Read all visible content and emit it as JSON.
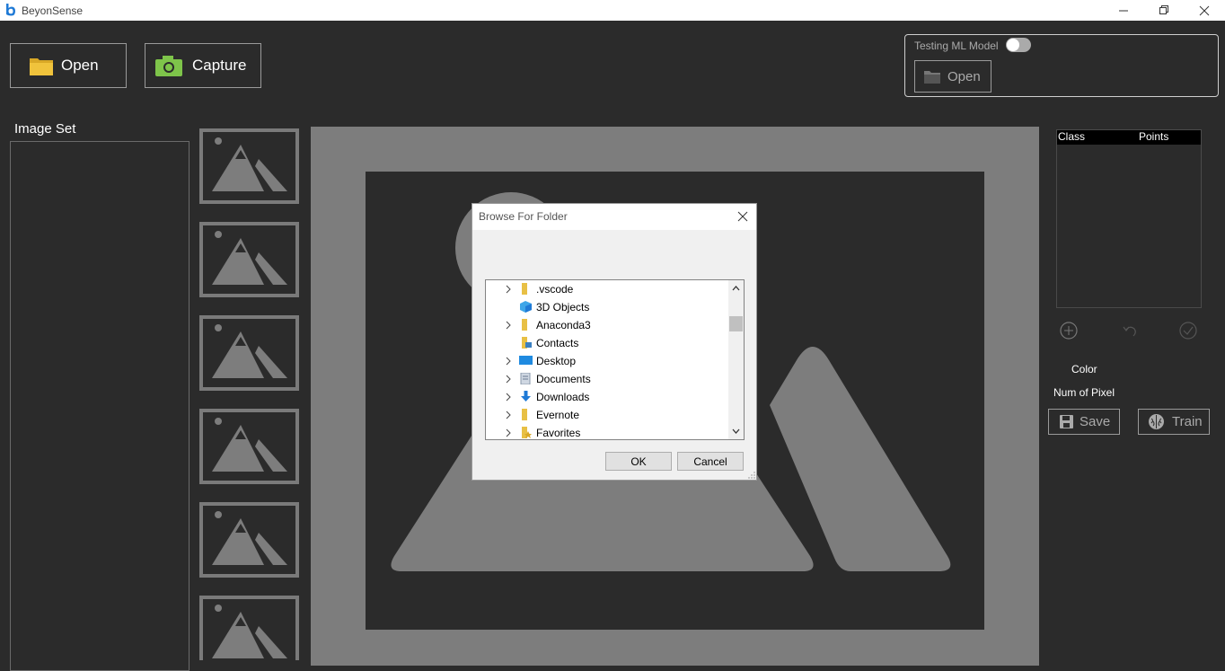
{
  "app": {
    "title": "BeyonSense"
  },
  "toolbar": {
    "open_label": "Open",
    "capture_label": "Capture"
  },
  "ml": {
    "label": "Testing ML Model",
    "toggle_on": false,
    "open_label": "Open"
  },
  "image_set": {
    "label": "Image Set"
  },
  "class_table": {
    "columns": [
      "Class",
      "Points"
    ]
  },
  "side": {
    "color_label": "Color",
    "num_pixel_label": "Num of Pixel",
    "save_label": "Save",
    "train_label": "Train"
  },
  "dialog": {
    "title": "Browse For Folder",
    "items": [
      {
        "name": ".vscode",
        "icon": "folder-icon",
        "expandable": true
      },
      {
        "name": "3D Objects",
        "icon": "3d-objects-icon",
        "expandable": false
      },
      {
        "name": "Anaconda3",
        "icon": "folder-icon",
        "expandable": true
      },
      {
        "name": "Contacts",
        "icon": "contacts-icon",
        "expandable": false
      },
      {
        "name": "Desktop",
        "icon": "desktop-icon",
        "expandable": true
      },
      {
        "name": "Documents",
        "icon": "documents-icon",
        "expandable": true
      },
      {
        "name": "Downloads",
        "icon": "downloads-icon",
        "expandable": true
      },
      {
        "name": "Evernote",
        "icon": "folder-icon",
        "expandable": true
      },
      {
        "name": "Favorites",
        "icon": "favorites-icon",
        "expandable": true
      }
    ],
    "ok_label": "OK",
    "cancel_label": "Cancel"
  },
  "colors": {
    "background": "#2b2b2b",
    "placeholder": "#7d7d7d",
    "folder": "#e8c045",
    "camera": "#7ec44a"
  }
}
